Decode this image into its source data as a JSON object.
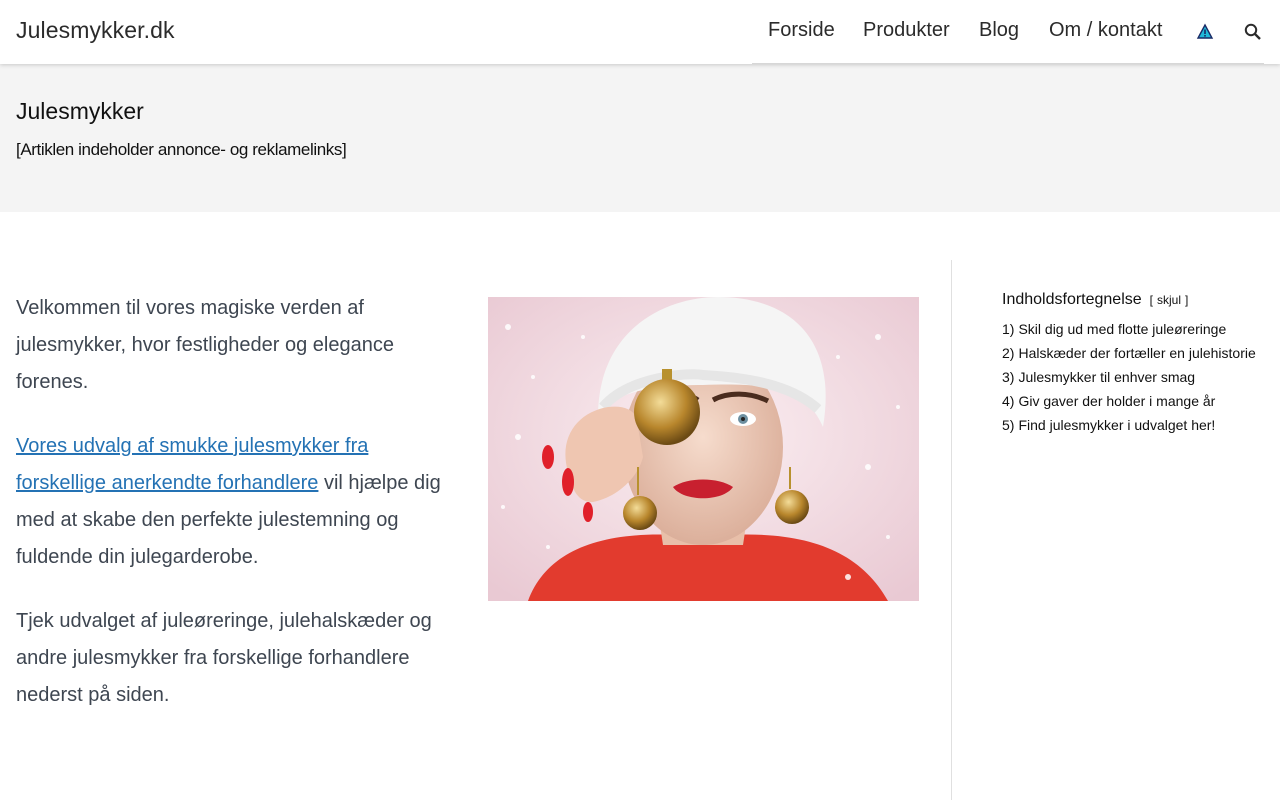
{
  "header": {
    "site_title": "Julesmykker.dk",
    "nav": [
      {
        "label": "Forside"
      },
      {
        "label": "Produkter"
      },
      {
        "label": "Blog"
      },
      {
        "label": "Om / kontakt"
      }
    ],
    "icons": [
      "warning-triangle-icon",
      "search-icon"
    ]
  },
  "page": {
    "title": "Julesmykker",
    "disclaimer": "[Artiklen indeholder annonce- og reklamelinks]"
  },
  "content": {
    "intro": "Velkommen til vores magiske verden af julesmykker, hvor festligheder og elegance forenes.",
    "link_text": "Vores udvalg af smukke julesmykker fra forskellige anerkendte forhandlere",
    "after_link": " vil hjælpe dig med at skabe den perfekte julestemning og fuldende din julegarderobe.",
    "closing": "Tjek udvalget af juleøreringe, julehalskæder og andre julesmykker fra forskellige forhandlere nederst på siden."
  },
  "toc": {
    "heading": "Indholdsfortegnelse",
    "toggle_open": "[",
    "toggle_label": "skjul",
    "toggle_close": "]",
    "items": [
      {
        "num": "1)",
        "label": "Skil dig ud med flotte juleøreringe"
      },
      {
        "num": "2)",
        "label": "Halskæder der fortæller en julehistorie"
      },
      {
        "num": "3)",
        "label": "Julesmykker til enhver smag"
      },
      {
        "num": "4)",
        "label": "Giv gaver der holder i mange år"
      },
      {
        "num": "5)",
        "label": "Find julesmykker i udvalget her!"
      }
    ]
  },
  "colors": {
    "link": "#2472b4",
    "band": "#f4f4f4",
    "text": "#3e4651"
  }
}
